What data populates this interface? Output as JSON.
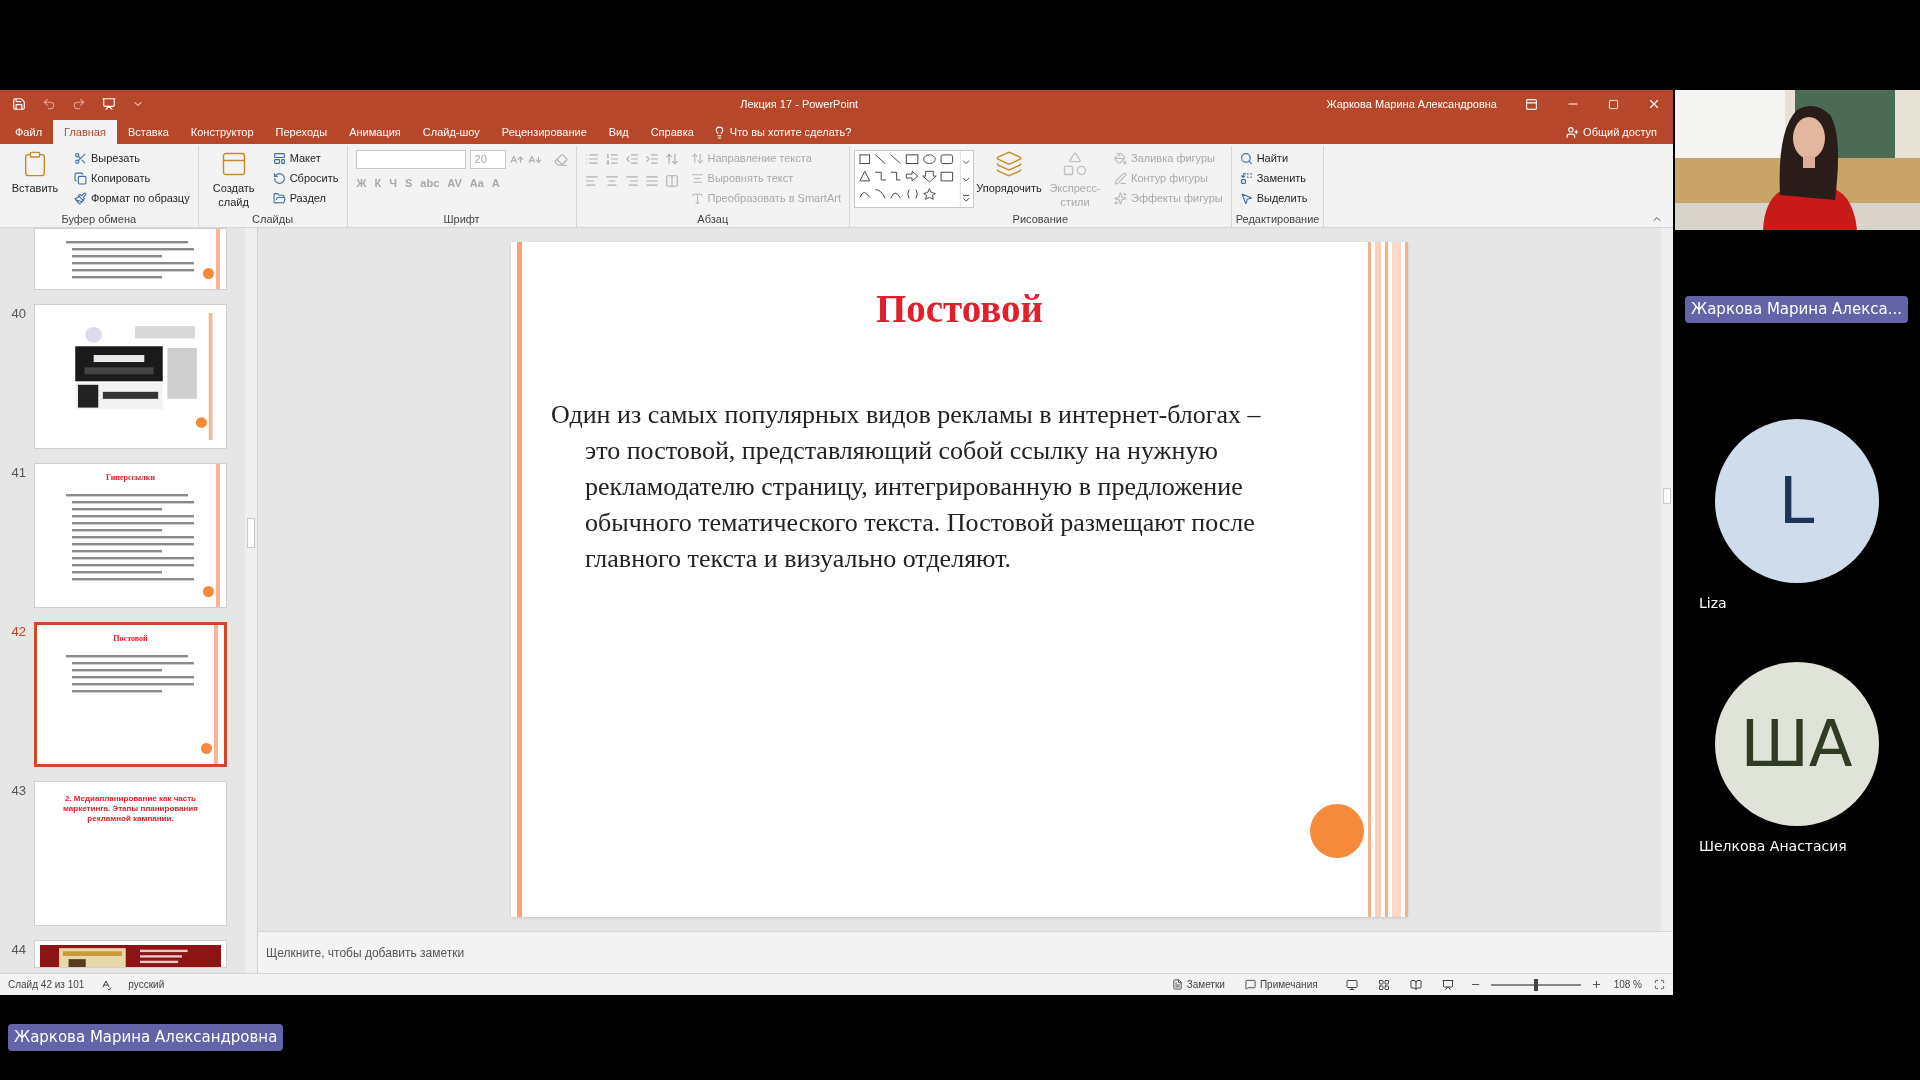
{
  "window": {
    "title": "Лекция 17 - PowerPoint",
    "user": "Жаркова Марина Александровна"
  },
  "tabs": [
    {
      "label": "Файл",
      "selected": false
    },
    {
      "label": "Главная",
      "selected": true
    },
    {
      "label": "Вставка",
      "selected": false
    },
    {
      "label": "Конструктор",
      "selected": false
    },
    {
      "label": "Переходы",
      "selected": false
    },
    {
      "label": "Анимация",
      "selected": false
    },
    {
      "label": "Слайд-шоу",
      "selected": false
    },
    {
      "label": "Рецензирование",
      "selected": false
    },
    {
      "label": "Вид",
      "selected": false
    },
    {
      "label": "Справка",
      "selected": false
    }
  ],
  "tell_me": "Что вы хотите сделать?",
  "share": "Общий доступ",
  "ribbon": {
    "groups": [
      {
        "kind": "clipboard",
        "label": "Буфер обмена",
        "items": [
          {
            "kind": "large",
            "label": "Вставить",
            "disabled": false
          },
          {
            "kind": "small",
            "label": "Вырезать",
            "disabled": false
          },
          {
            "kind": "small",
            "label": "Копировать",
            "disabled": false
          },
          {
            "kind": "small",
            "label": "Формат по образцу",
            "disabled": false
          }
        ]
      },
      {
        "kind": "slides",
        "label": "Слайды",
        "items": [
          {
            "kind": "large",
            "label": "Создать слайд",
            "disabled": false
          },
          {
            "kind": "small",
            "label": "Макет",
            "disabled": false
          },
          {
            "kind": "small",
            "label": "Сбросить",
            "disabled": false
          },
          {
            "kind": "small",
            "label": "Раздел",
            "disabled": false
          }
        ]
      },
      {
        "kind": "font",
        "label": "Шрифт",
        "font_size": "20",
        "format_buttons": [
          "Ж",
          "К",
          "Ч",
          "S",
          "abc",
          "AV",
          "Aa",
          "A"
        ]
      },
      {
        "kind": "paragraph",
        "label": "Абзац",
        "items": [
          {
            "kind": "small",
            "label": "Направление текста",
            "disabled": true
          },
          {
            "kind": "small",
            "label": "Выровнять текст",
            "disabled": true
          },
          {
            "kind": "small",
            "label": "Преобразовать в SmartArt",
            "disabled": true
          }
        ]
      },
      {
        "kind": "drawing",
        "label": "Рисование",
        "items": [
          {
            "kind": "shapes"
          },
          {
            "kind": "large",
            "label": "Упорядочить",
            "disabled": false
          },
          {
            "kind": "large",
            "label": "Экспресс-стили",
            "disabled": true
          },
          {
            "kind": "small",
            "label": "Заливка фигуры",
            "disabled": true
          },
          {
            "kind": "small",
            "label": "Контур фигуры",
            "disabled": true
          },
          {
            "kind": "small",
            "label": "Эффекты фигуры",
            "disabled": true
          }
        ]
      },
      {
        "kind": "editing",
        "label": "Редактирование",
        "items": [
          {
            "kind": "small",
            "label": "Найти",
            "disabled": false
          },
          {
            "kind": "small",
            "label": "Заменить",
            "disabled": false
          },
          {
            "kind": "small",
            "label": "Выделить",
            "disabled": false
          }
        ]
      }
    ]
  },
  "thumbnails": [
    {
      "kind": "text",
      "selected": false
    },
    {
      "number": "40",
      "kind": "picture",
      "selected": false
    },
    {
      "number": "41",
      "kind": "text",
      "title": "Гиперссылки",
      "selected": false
    },
    {
      "number": "42",
      "kind": "text",
      "title": "Постовой",
      "selected": true
    },
    {
      "number": "43",
      "kind": "title",
      "title": "2. Медиапланирование как часть маркетинга. Этапы планирования рекламной кампании.",
      "selected": false
    },
    {
      "number": "44",
      "kind": "picture",
      "selected": false
    }
  ],
  "slide": {
    "title": "Постовой",
    "body": "Один из самых популярных видов рекламы в интернет-блогах – это постовой, представляющий собой ссылку на нужную рекламодателю страницу, интегрированную в предложение обычного тематического текста. Постовой размещают после главного текста и визуально отделяют."
  },
  "notes_placeholder": "Щелкните, чтобы добавить заметки",
  "status_bar": {
    "slide": "Слайд 42 из 101",
    "language": "русский",
    "notes": "Заметки",
    "comments": "Примечания",
    "zoom": {
      "level": 0.5,
      "reading": "108 %"
    }
  },
  "participants": [
    {
      "kind": "video",
      "name": "Жаркова Марина Алекса..."
    },
    {
      "kind": "avatar",
      "initials": "L",
      "name": "Liza",
      "color": "#cfdcec"
    },
    {
      "kind": "avatar",
      "initials": "ША",
      "name": "Шелкова Анастасия",
      "color": "#dfe3d8"
    }
  ],
  "presenter_tag": "Жаркова Марина Александровна"
}
